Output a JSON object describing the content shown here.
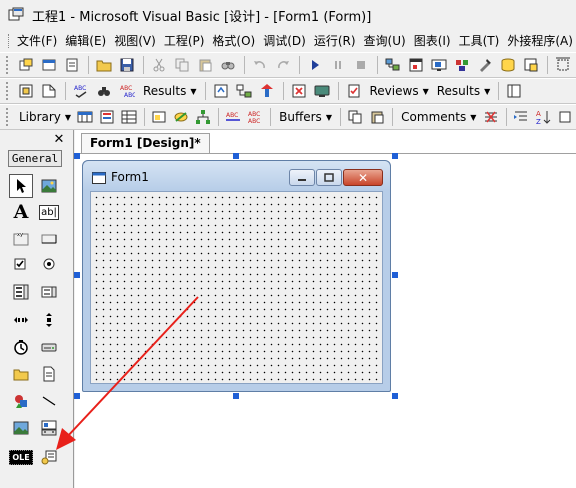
{
  "window": {
    "title": "工程1 - Microsoft Visual Basic [设计] - [Form1 (Form)]",
    "app_icon": "vb-project-icon"
  },
  "menu": {
    "items": [
      "文件(F)",
      "编辑(E)",
      "视图(V)",
      "工程(P)",
      "格式(O)",
      "调试(D)",
      "运行(R)",
      "查询(U)",
      "图表(I)",
      "工具(T)",
      "外接程序(A)"
    ]
  },
  "toolbars": {
    "row1": {
      "icons": [
        "add-project-icon",
        "add-form-icon",
        "menu-editor-icon",
        "open-icon",
        "save-icon",
        "cut-icon",
        "copy-icon",
        "paste-icon",
        "find-icon",
        "undo-icon",
        "redo-icon",
        "run-icon",
        "pause-icon",
        "stop-icon",
        "project-explorer-icon",
        "properties-icon",
        "form-layout-icon",
        "object-browser-icon",
        "toolbox-icon",
        "data-view-icon",
        "component-manager-icon"
      ]
    },
    "row2": {
      "results_label": "Results",
      "reviews_label": "Reviews",
      "results2_label": "Results"
    },
    "row3": {
      "library_label": "Library",
      "buffers_label": "Buffers",
      "comments_label": "Comments"
    }
  },
  "toolbox": {
    "header": "General",
    "close_glyph": "✕",
    "tools": [
      "pointer-icon",
      "picturebox-icon",
      "label-icon",
      "textbox-icon",
      "frame-icon",
      "commandbutton-icon",
      "checkbox-icon",
      "optionbutton-icon",
      "combobox-icon",
      "listbox-icon",
      "hscrollbar-icon",
      "vscrollbar-icon",
      "timer-icon",
      "drivelistbox-icon",
      "dirlistbox-icon",
      "filelistbox-icon",
      "shape-icon",
      "line-icon",
      "image-icon",
      "data-icon",
      "ole-icon",
      "adodc-icon"
    ],
    "label_glyph": "A",
    "textbox_glyph": "ab|",
    "ole_glyph": "OLE"
  },
  "document": {
    "tab_label": "Form1 [Design]*"
  },
  "form": {
    "caption": "Form1",
    "backcolor": "#f0f0f0",
    "title_color": "#b7cde8"
  },
  "annotation": {
    "arrow_color": "#e8201a"
  }
}
